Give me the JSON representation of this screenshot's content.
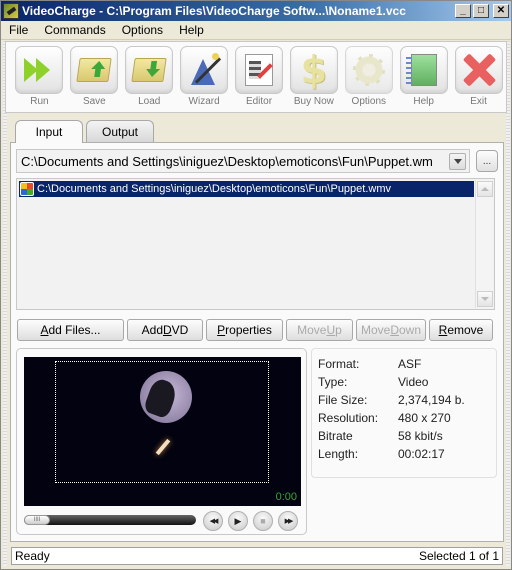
{
  "window": {
    "title": "VideoCharge - C:\\Program Files\\VideoCharge Softw...\\Noname1.vcc",
    "minimize": "_",
    "maximize": "□",
    "close": "✕"
  },
  "menu": [
    "File",
    "Commands",
    "Options",
    "Help"
  ],
  "toolbar": [
    {
      "label": "Run",
      "icon": "run-icon",
      "enabled": true
    },
    {
      "label": "Save",
      "icon": "save-icon",
      "enabled": true
    },
    {
      "label": "Load",
      "icon": "load-icon",
      "enabled": true
    },
    {
      "label": "Wizard",
      "icon": "wizard-icon",
      "enabled": true
    },
    {
      "label": "Editor",
      "icon": "editor-icon",
      "enabled": true
    },
    {
      "label": "Buy Now",
      "icon": "dollar-icon",
      "enabled": true
    },
    {
      "label": "Options",
      "icon": "gear-icon",
      "enabled": false
    },
    {
      "label": "Help",
      "icon": "help-book-icon",
      "enabled": true
    },
    {
      "label": "Exit",
      "icon": "exit-x-icon",
      "enabled": true
    }
  ],
  "tabs": [
    {
      "label": "Input",
      "active": true
    },
    {
      "label": "Output",
      "active": false
    }
  ],
  "input": {
    "path_combo_value": "C:\\Documents and Settings\\iniguez\\Desktop\\emoticons\\Fun\\Puppet.wm",
    "browse_label": "...",
    "files": [
      {
        "path": "C:\\Documents and Settings\\iniguez\\Desktop\\emoticons\\Fun\\Puppet.wmv",
        "selected": true
      }
    ]
  },
  "buttons": [
    {
      "label_pre": "",
      "label_ul": "A",
      "label_post": "dd Files...",
      "enabled": true
    },
    {
      "label_pre": "Add ",
      "label_ul": "D",
      "label_post": "VD",
      "enabled": true
    },
    {
      "label_pre": "",
      "label_ul": "P",
      "label_post": "roperties",
      "enabled": true
    },
    {
      "label_pre": "Move ",
      "label_ul": "U",
      "label_post": "p",
      "enabled": false
    },
    {
      "label_pre": "Move ",
      "label_ul": "D",
      "label_post": "own",
      "enabled": false
    },
    {
      "label_pre": "",
      "label_ul": "R",
      "label_post": "emove",
      "enabled": true
    }
  ],
  "player": {
    "timecode": "0:00",
    "seek_position": 0,
    "seek_thumb": "IIII",
    "controls": {
      "rewind": "◀◀",
      "play": "▶",
      "stop": "■",
      "forward": "▶▶"
    }
  },
  "info": [
    {
      "key": "Format:",
      "value": "ASF"
    },
    {
      "key": "Type:",
      "value": "Video"
    },
    {
      "key": "File Size:",
      "value": "2,374,194 b."
    },
    {
      "key": "Resolution:",
      "value": "480 x 270"
    },
    {
      "key": "Bitrate",
      "value": "58 kbit/s"
    },
    {
      "key": "Length:",
      "value": "00:02:17"
    }
  ],
  "status": {
    "left": "Ready",
    "right": "Selected 1 of 1"
  }
}
